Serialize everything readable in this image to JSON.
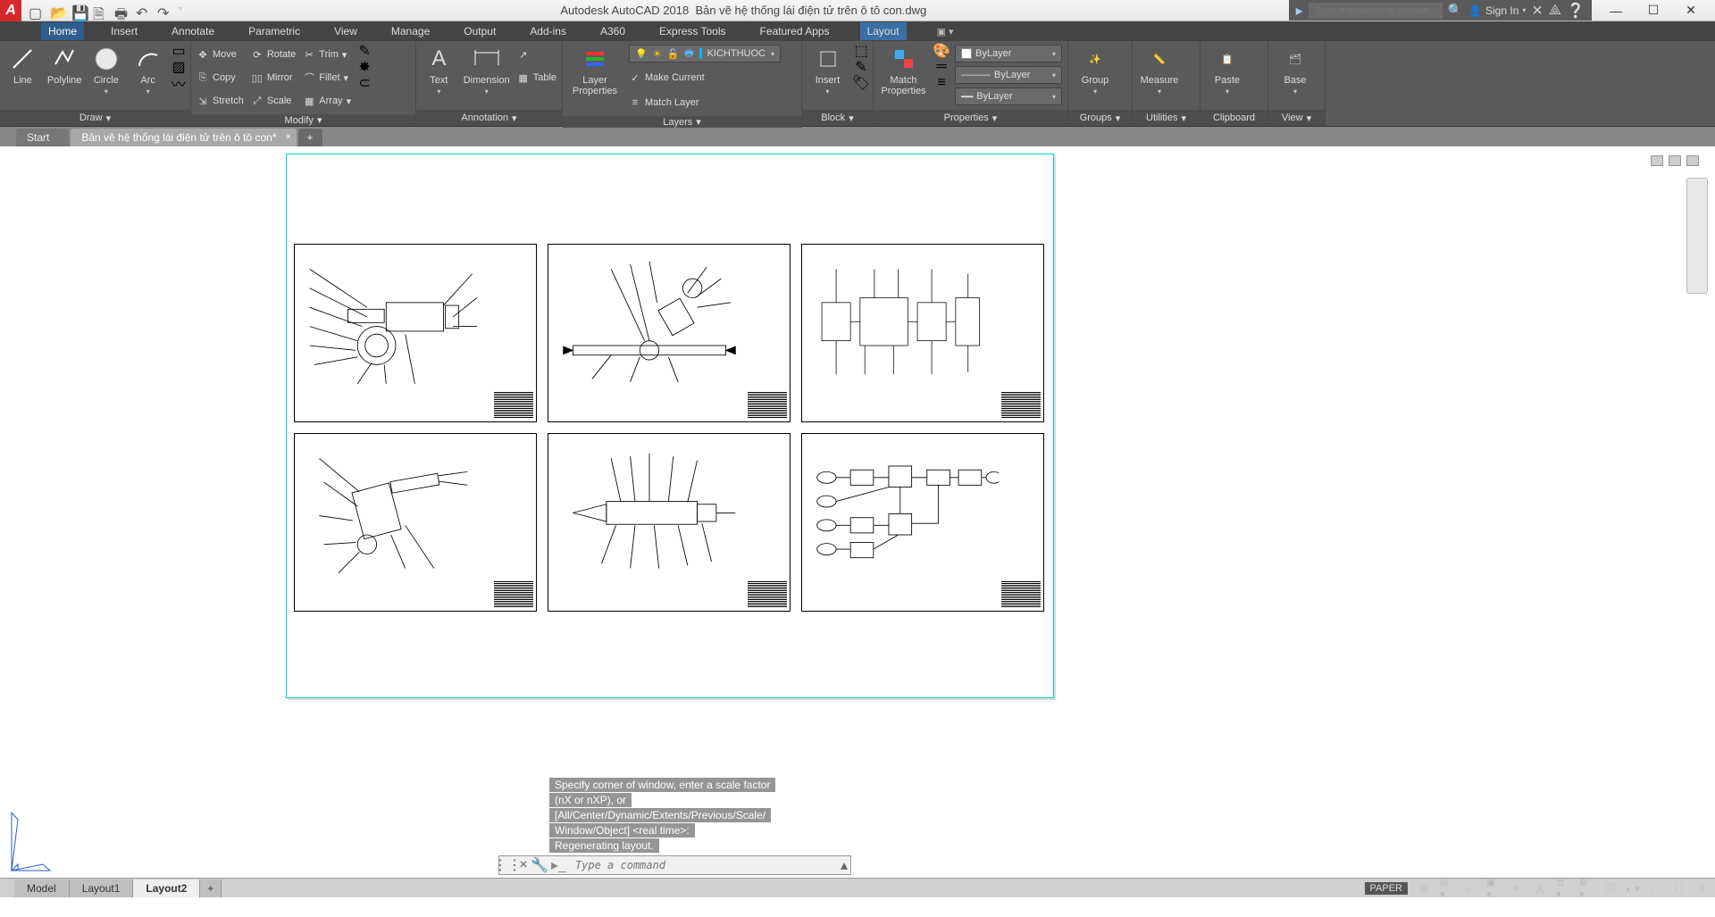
{
  "app_title": "Autodesk AutoCAD 2018",
  "doc_name": "Bản vẽ hệ thống lái điện tử trên ô tô con.dwg",
  "search_placeholder": "Type a keyword or phrase",
  "signin_label": "Sign In",
  "ribbon_tabs": [
    "Home",
    "Insert",
    "Annotate",
    "Parametric",
    "View",
    "Manage",
    "Output",
    "Add-ins",
    "A360",
    "Express Tools",
    "Featured Apps",
    "Layout"
  ],
  "active_ribbon_tab": "Home",
  "panels": {
    "draw": {
      "label": "Draw",
      "big": [
        "Line",
        "Polyline",
        "Circle",
        "Arc"
      ]
    },
    "modify": {
      "label": "Modify",
      "items": [
        "Move",
        "Copy",
        "Stretch",
        "Rotate",
        "Mirror",
        "Scale",
        "Trim",
        "Fillet",
        "Array"
      ]
    },
    "annotation": {
      "label": "Annotation",
      "big": [
        "Text",
        "Dimension"
      ],
      "items": [
        "Leader",
        "Table"
      ]
    },
    "layers": {
      "label": "Layers",
      "big": "Layer\nProperties",
      "current_layer": "KICHTHUOC",
      "items": [
        "Make Current",
        "Match Layer"
      ]
    },
    "block": {
      "label": "Block",
      "big": "Insert"
    },
    "properties": {
      "label": "Properties",
      "big": "Match\nProperties",
      "color": "ByLayer",
      "ltype": "ByLayer",
      "lweight": "ByLayer"
    },
    "groups": {
      "label": "Groups",
      "big": "Group"
    },
    "utilities": {
      "label": "Utilities",
      "big": "Measure"
    },
    "clipboard": {
      "label": "Clipboard",
      "big": "Paste"
    },
    "view": {
      "label": "View",
      "big": "Base"
    }
  },
  "file_tabs": [
    {
      "label": "Start",
      "active": false
    },
    {
      "label": "Bản vẽ hệ thống lái điện tử trên ô tô con*",
      "active": true
    }
  ],
  "layout_tabs": [
    "Model",
    "Layout1",
    "Layout2"
  ],
  "active_layout": "Layout2",
  "cmd_history": [
    "Specify corner of window, enter a scale factor",
    "(nX or nXP), or",
    "[All/Center/Dynamic/Extents/Previous/Scale/",
    "Window/Object] <real time>:",
    "Regenerating layout."
  ],
  "cmd_placeholder": "Type a command",
  "status_right": {
    "space": "PAPER"
  },
  "colors": {
    "layer_swatch": "#00b9f2",
    "bylayer_swatch": "#ffffff",
    "layout_accent": "#00d0d0"
  }
}
